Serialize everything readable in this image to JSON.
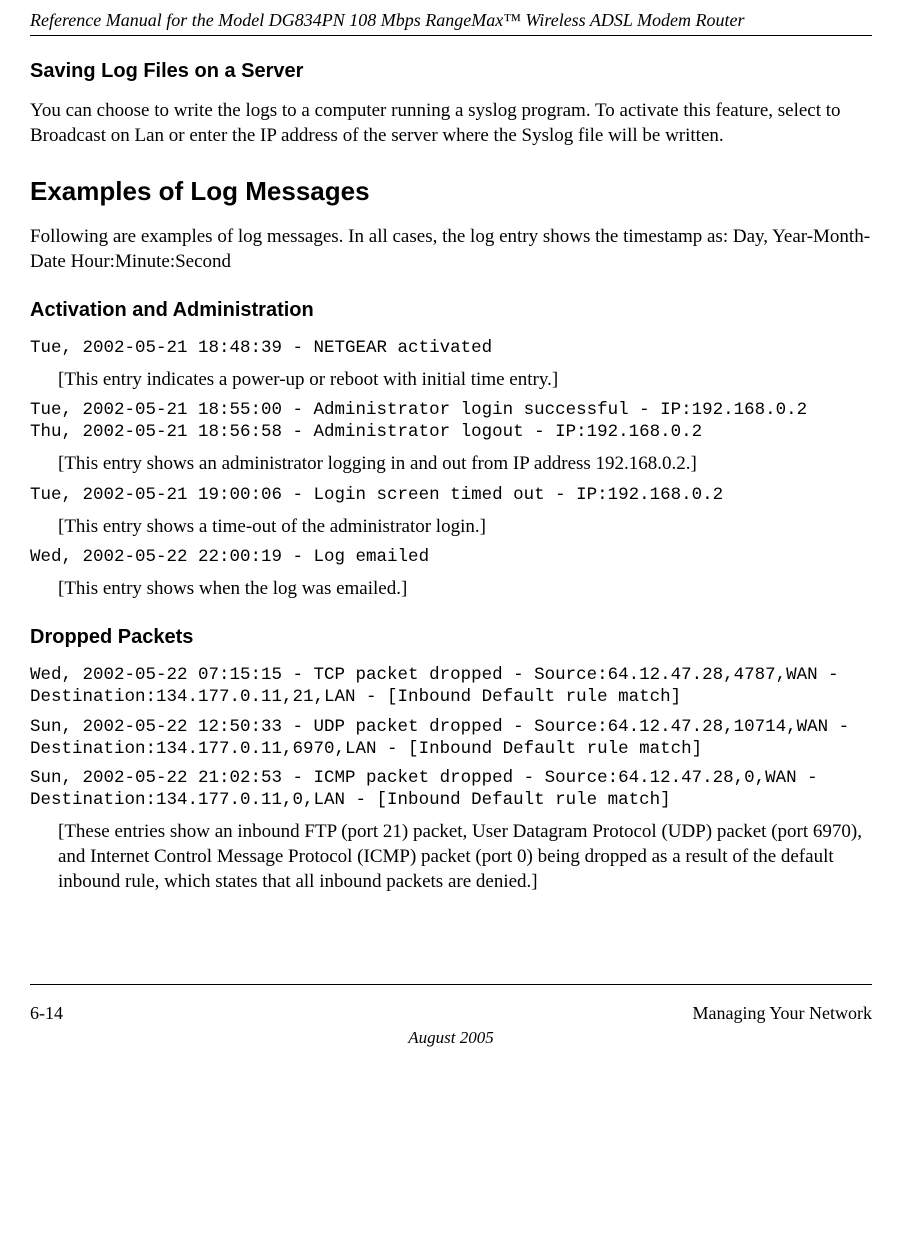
{
  "header": {
    "running_title": "Reference Manual for the Model DG834PN 108 Mbps RangeMax™ Wireless ADSL Modem Router"
  },
  "section1": {
    "heading": "Saving Log Files on a Server",
    "paragraph": "You can choose to write the logs to a computer running a syslog program. To activate this feature, select to Broadcast on Lan or enter the IP address of the server where the Syslog file will be written."
  },
  "section2": {
    "heading": "Examples of Log Messages",
    "intro": "Following are examples of log messages. In all cases, the log entry shows the timestamp as:    Day, Year-Month-Date  Hour:Minute:Second"
  },
  "subA": {
    "heading": "Activation and Administration",
    "log1": "Tue, 2002-05-21 18:48:39 - NETGEAR activated ",
    "note1": "[This entry indicates a power-up or reboot with initial time entry.]",
    "log2": "Tue, 2002-05-21 18:55:00 - Administrator login successful - IP:192.168.0.2 \nThu, 2002-05-21 18:56:58 - Administrator logout - IP:192.168.0.2 ",
    "note2": "[This entry shows an administrator logging in and out from IP address 192.168.0.2.]",
    "log3": "Tue, 2002-05-21 19:00:06 - Login screen timed out - IP:192.168.0.2",
    "note3": "[This entry shows a time-out of the administrator login.]",
    "log4": "Wed, 2002-05-22 22:00:19 - Log emailed",
    "note4": "[This entry shows when the log was emailed.]"
  },
  "subB": {
    "heading": "Dropped Packets",
    "log1": "Wed, 2002-05-22 07:15:15 - TCP packet dropped - Source:64.12.47.28,4787,WAN - Destination:134.177.0.11,21,LAN - [Inbound Default rule match]",
    "log2": "Sun, 2002-05-22 12:50:33 - UDP packet dropped - Source:64.12.47.28,10714,WAN - Destination:134.177.0.11,6970,LAN - [Inbound Default rule match]",
    "log3": "Sun, 2002-05-22 21:02:53 - ICMP packet dropped - Source:64.12.47.28,0,WAN - Destination:134.177.0.11,0,LAN - [Inbound Default rule match]",
    "note": "[These entries show an inbound FTP (port 21) packet, User Datagram Protocol (UDP) packet (port 6970), and Internet Control Message Protocol (ICMP) packet (port 0) being dropped as a result of the default inbound rule, which states that all inbound packets are denied.]"
  },
  "footer": {
    "page_number": "6-14",
    "section_name": "Managing Your Network",
    "date": "August 2005"
  }
}
